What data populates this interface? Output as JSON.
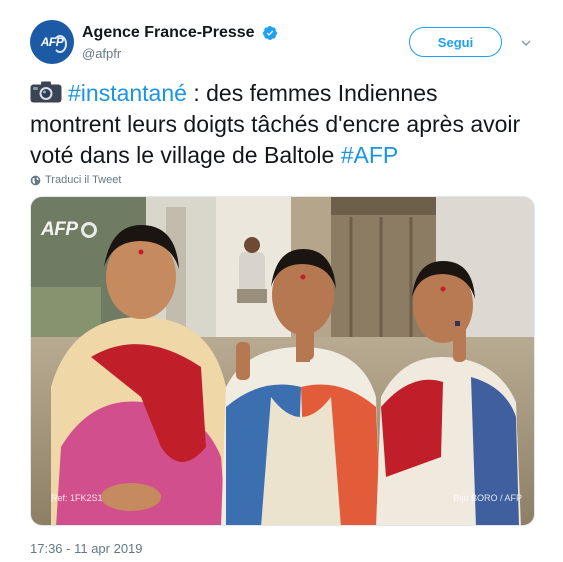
{
  "account": {
    "name": "Agence France-Presse",
    "handle": "@afpfr",
    "avatar_text": "AFP",
    "verified": true
  },
  "actions": {
    "follow_label": "Segui"
  },
  "tweet": {
    "camera_emoji": "📷",
    "hashtag_1": "#instantané",
    "text_body": " : des femmes Indiennes montrent leurs doigts tâchés d'encre après avoir voté dans le village de Baltole ",
    "hashtag_2": "#AFP",
    "translate_label": "Traduci il Tweet",
    "timestamp": "17:36 - 11 apr 2019"
  },
  "media": {
    "watermark": "AFP",
    "ref_text": "Ref:  1FK2S1",
    "credit_text": "Biju BORO / AFP"
  },
  "colors": {
    "accent": "#1da1f2",
    "hashtag": "#1b95e0",
    "verified": "#1da1f2",
    "secondary_text": "#657786"
  }
}
